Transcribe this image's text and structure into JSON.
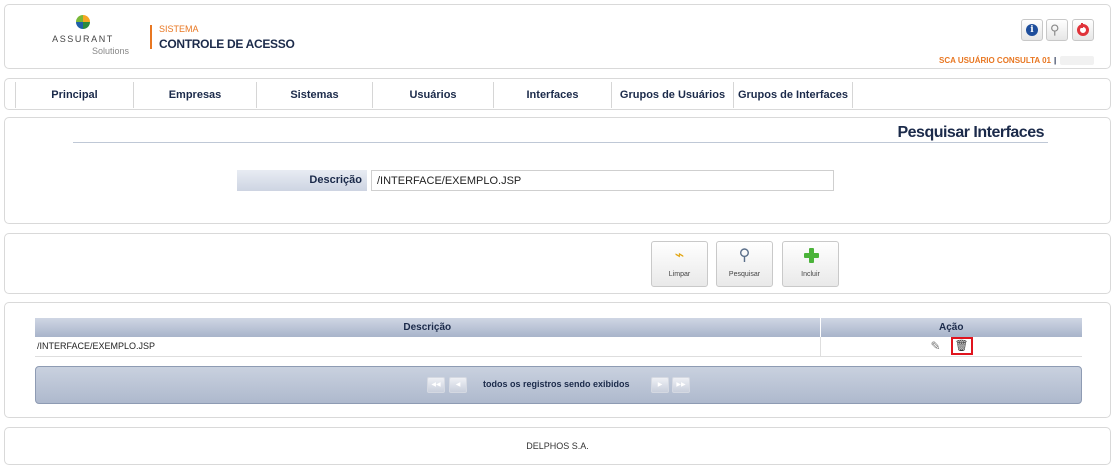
{
  "header": {
    "logo_word": "ASSURANT",
    "logo_sub": "Solutions",
    "system_small": "SISTEMA",
    "system_title": "CONTROLE DE ACESSO",
    "user_label": "SCA USUÁRIO CONSULTA 01",
    "user_separator": "|",
    "icons": [
      "info-icon",
      "key-icon",
      "power-icon"
    ]
  },
  "nav": {
    "items": [
      "Principal",
      "Empresas",
      "Sistemas",
      "Usuários",
      "Interfaces",
      "Grupos de Usuários",
      "Grupos de Interfaces"
    ]
  },
  "search": {
    "title": "Pesquisar Interfaces",
    "label": "Descrição",
    "value": "/INTERFACE/EXEMPLO.JSP"
  },
  "actions": {
    "limpar": "Limpar",
    "pesquisar": "Pesquisar",
    "incluir": "Incluir"
  },
  "results": {
    "columns": [
      "Descrição",
      "Ação"
    ],
    "rows": [
      {
        "descricao": "/INTERFACE/EXEMPLO.JSP"
      }
    ],
    "pager_text": "todos os registros sendo exibidos"
  },
  "footer": {
    "text": "DELPHOS S.A."
  },
  "colors": {
    "accent": "#e87722",
    "navy": "#1b2a4a",
    "delete_highlight": "#e0141e"
  }
}
